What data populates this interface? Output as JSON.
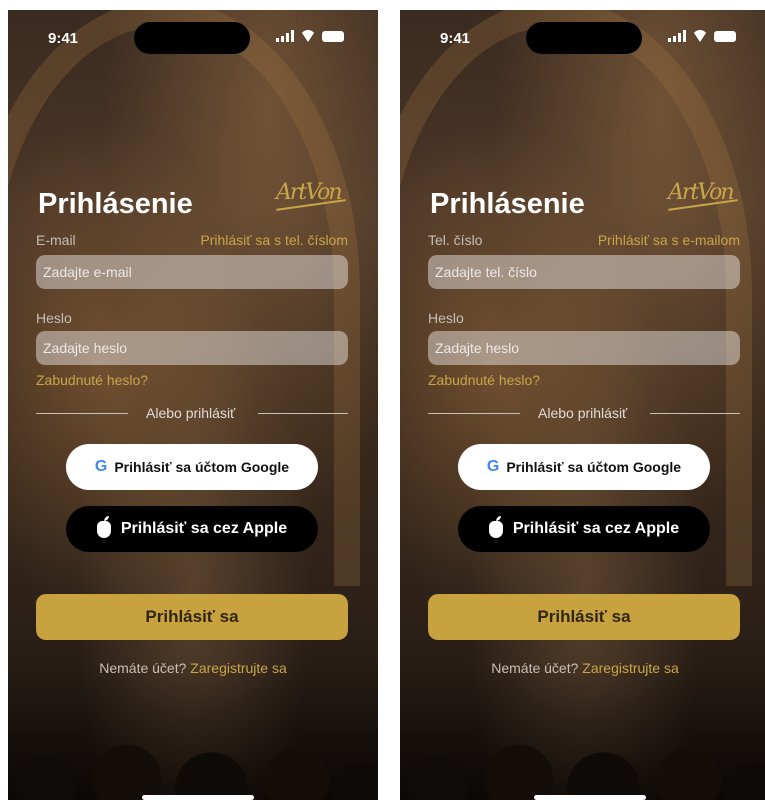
{
  "status": {
    "time": "9:41"
  },
  "screens": [
    {
      "title": "Prihlásenie",
      "logo_text": "ArtVon",
      "field1_label": "E-mail",
      "switch_label": "Prihlásiť sa s tel. číslom",
      "field1_placeholder": "Zadajte e-mail",
      "field2_label": "Heslo",
      "field2_placeholder": "Zadajte heslo",
      "forgot": "Zabudnuté heslo?",
      "divider": "Alebo prihlásiť",
      "google_button": "Prihlásiť sa účtom Google",
      "google_icon": "G",
      "apple_button": "Prihlásiť sa cez Apple",
      "login_button": "Prihlásiť sa",
      "register_prompt": "Nemáte účet?",
      "register_link": "Zaregistrujte sa"
    },
    {
      "title": "Prihlásenie",
      "logo_text": "ArtVon",
      "field1_label": "Tel. číslo",
      "switch_label": "Prihlásiť sa s e-mailom",
      "field1_placeholder": "Zadajte tel. číslo",
      "field2_label": "Heslo",
      "field2_placeholder": "Zadajte heslo",
      "forgot": "Zabudnuté heslo?",
      "divider": "Alebo prihlásiť",
      "google_button": "Prihlásiť sa účtom Google",
      "google_icon": "G",
      "apple_button": "Prihlásiť sa cez Apple",
      "login_button": "Prihlásiť sa",
      "register_prompt": "Nemáte účet?",
      "register_link": "Zaregistrujte sa"
    }
  ],
  "colors": {
    "accent": "#c8a23f",
    "input_bg": "rgba(255,255,255,0.42)",
    "text": "#ffffff"
  }
}
